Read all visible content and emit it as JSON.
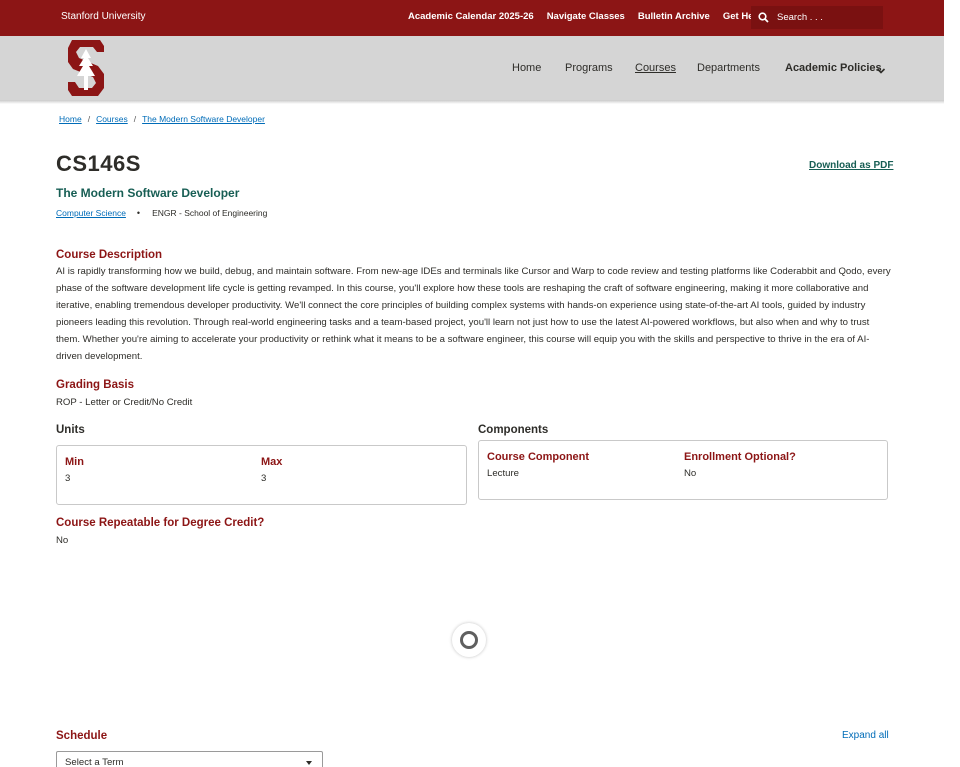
{
  "topbar": {
    "brand": "Stanford University",
    "links": [
      "Academic Calendar 2025-26",
      "Navigate Classes",
      "Bulletin Archive",
      "Get Help"
    ],
    "search_placeholder": "Search . . ."
  },
  "nav": {
    "items": [
      "Home",
      "Programs",
      "Courses",
      "Departments"
    ],
    "dropdown_label": "Academic Policies",
    "active": "Courses"
  },
  "breadcrumb": [
    "Home",
    "Courses",
    "The Modern Software Developer"
  ],
  "course": {
    "code": "CS146S",
    "title": "The Modern Software Developer",
    "department": "Computer Science",
    "school": "ENGR - School of Engineering",
    "download_label": "Download as PDF"
  },
  "description": {
    "heading": "Course Description",
    "text": "AI is rapidly transforming how we build, debug, and maintain software. From new-age IDEs and terminals like Cursor and Warp to code review and testing platforms like Coderabbit and Qodo, every phase of the software development life cycle is getting revamped. In this course, you'll explore how these tools are reshaping the craft of software engineering, making it more collaborative and iterative, enabling tremendous developer productivity. We'll connect the core principles of building complex systems with hands-on experience using state-of-the-art AI tools, guided by industry pioneers leading this revolution. Through real-world engineering tasks and a team-based project, you'll learn not just how to use the latest AI-powered workflows, but also when and why to trust them. Whether you're aiming to accelerate your productivity or rethink what it means to be a software engineer, this course will equip you with the skills and perspective to thrive in the era of AI-driven development."
  },
  "grading": {
    "heading": "Grading Basis",
    "value": "ROP - Letter or Credit/No Credit"
  },
  "units": {
    "heading": "Units",
    "min_label": "Min",
    "min_value": "3",
    "max_label": "Max",
    "max_value": "3"
  },
  "components": {
    "heading": "Components",
    "component_label": "Course Component",
    "component_value": "Lecture",
    "optional_label": "Enrollment Optional?",
    "optional_value": "No"
  },
  "repeatable": {
    "heading": "Course Repeatable for Degree Credit?",
    "value": "No"
  },
  "schedule": {
    "heading": "Schedule",
    "expand_label": "Expand all",
    "select_value": "Select a Term"
  },
  "colors": {
    "cardinal": "#8c1515",
    "header_gray": "#d5d5d5",
    "link_blue": "#006cb8",
    "palo_alto_green": "#175e54"
  }
}
